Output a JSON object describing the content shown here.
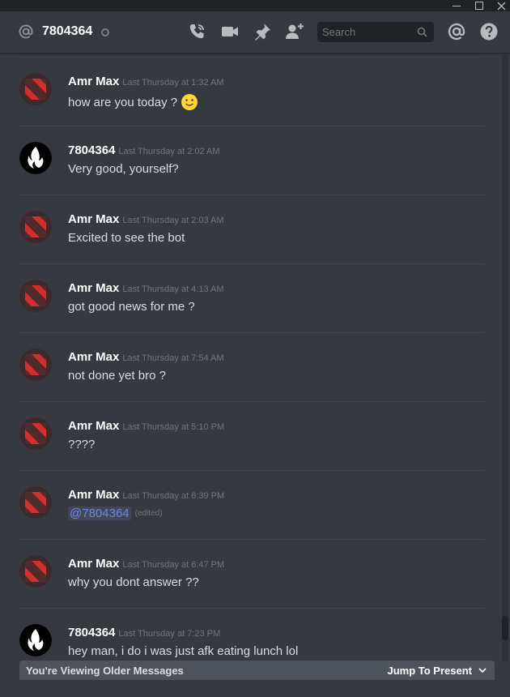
{
  "header": {
    "channel_name": "7804364",
    "search_placeholder": "Search"
  },
  "messages": [
    {
      "author": "Amr Max",
      "timestamp": "Last Thursday at 1:32 AM",
      "text": "how are you today ?",
      "avatar": "dota-red-logo"
    },
    {
      "author": "7804364",
      "timestamp": "Last Thursday at 2:02 AM",
      "text": "Very good, yourself?",
      "avatar": "black-flame-logo"
    },
    {
      "author": "Amr Max",
      "timestamp": "Last Thursday at 2:03 AM",
      "text": "Excited to see the bot",
      "avatar": "dota-red-logo"
    },
    {
      "author": "Amr Max",
      "timestamp": "Last Thursday at 4:13 AM",
      "text": "got good news for me ?",
      "avatar": "dota-red-logo"
    },
    {
      "author": "Amr Max",
      "timestamp": "Last Thursday at 7:54 AM",
      "text": "not done yet bro ?",
      "avatar": "dota-red-logo"
    },
    {
      "author": "Amr Max",
      "timestamp": "Last Thursday at 5:10 PM",
      "text": "????",
      "avatar": "dota-red-logo"
    },
    {
      "author": "Amr Max",
      "timestamp": "Last Thursday at 6:39 PM",
      "text": "@7804364",
      "edited": "(edited)",
      "avatar": "dota-red-logo"
    },
    {
      "author": "Amr Max",
      "timestamp": "Last Thursday at 6:47 PM",
      "text": "why you dont answer ??",
      "avatar": "dota-red-logo"
    },
    {
      "author": "7804364",
      "timestamp": "Last Thursday at 7:23 PM",
      "text": "hey man, i do i was just afk eating lunch lol",
      "avatar": "black-flame-logo"
    }
  ],
  "older_bar": {
    "label": "You're Viewing Older Messages",
    "jump_label": "Jump To Present"
  },
  "colors": {
    "background": "#36393f",
    "mention": "#7289da",
    "avatar_red": "#d32f2f"
  }
}
